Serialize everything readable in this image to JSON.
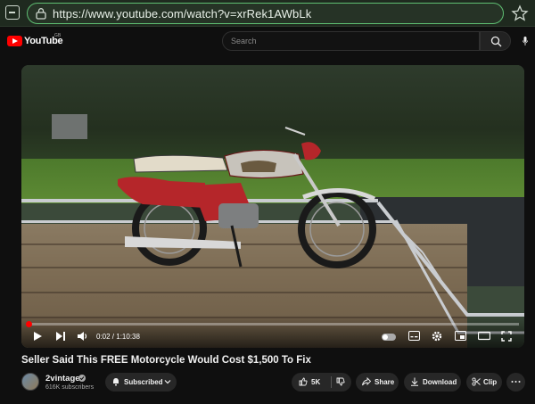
{
  "browser": {
    "url": "https://www.youtube.com/watch?v=xrRek1AWbLk"
  },
  "header": {
    "logo_text": "YouTube",
    "region": "GB",
    "search_placeholder": "Search"
  },
  "player": {
    "time_current": "0:02",
    "time_total": "1:10:38",
    "progress_fraction": 0.003
  },
  "video": {
    "title": "Seller Said This FREE Motorcycle Would Cost $1,500 To Fix",
    "channel": "2vintage",
    "subscribers": "616K subscribers",
    "subscribe_label": "Subscribed",
    "like_count": "5K",
    "share_label": "Share",
    "download_label": "Download",
    "clip_label": "Clip"
  },
  "colors": {
    "accent": "#ff0000",
    "url_border": "#5fbf73"
  }
}
